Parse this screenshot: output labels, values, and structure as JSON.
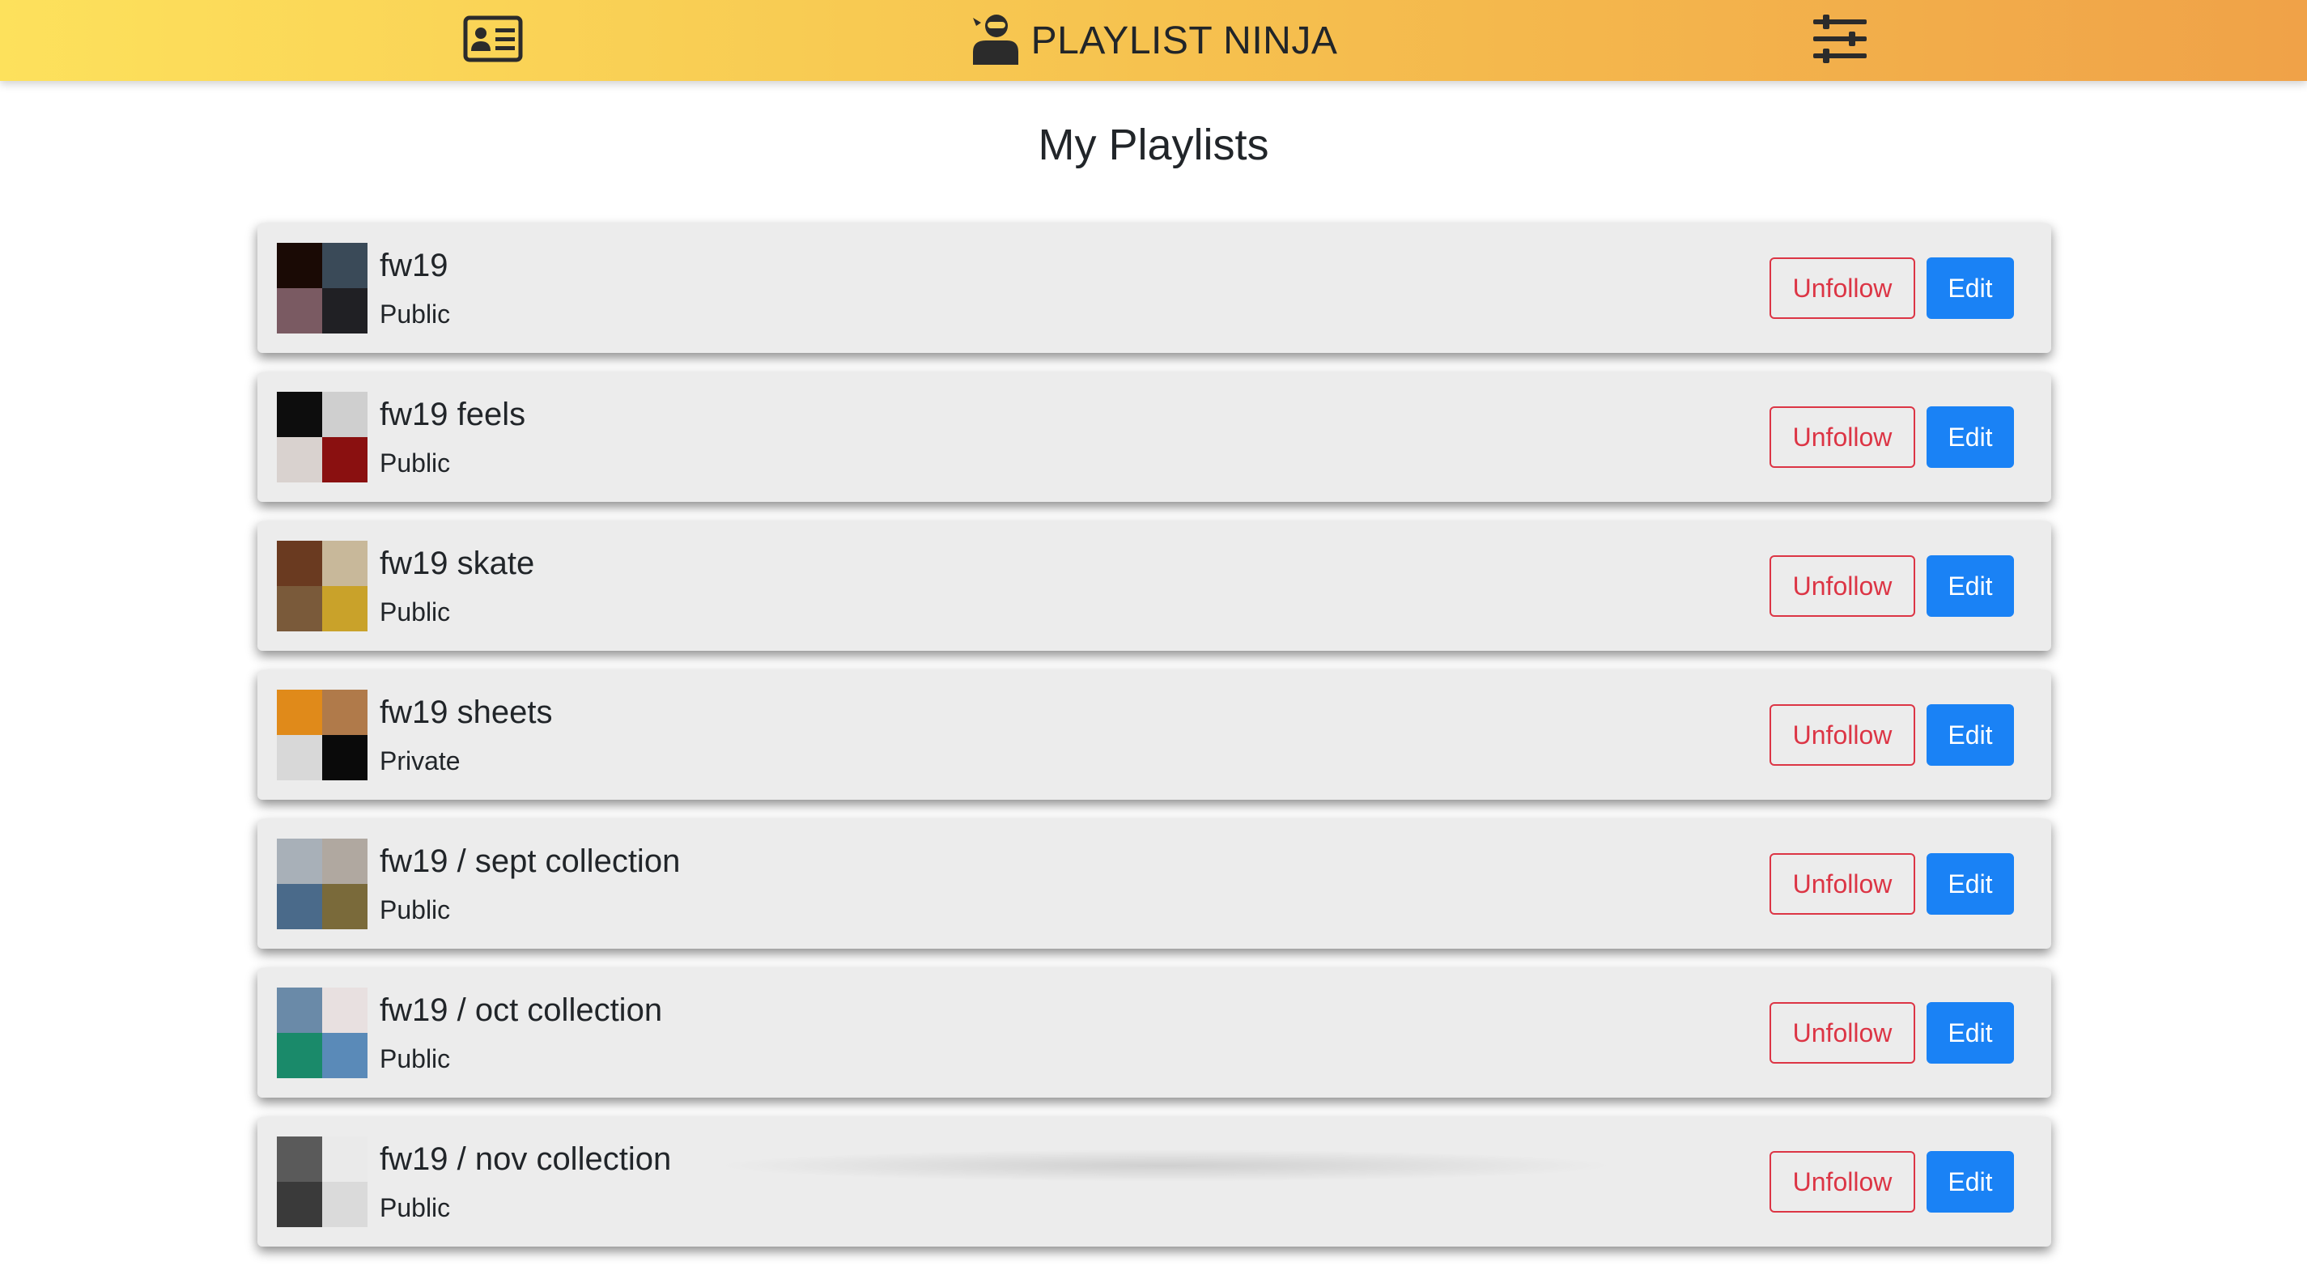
{
  "header": {
    "brand_title": "PLAYLIST NINJA",
    "gradient_colors": [
      "#fde15c",
      "#f0a248"
    ],
    "left_icon": "id-card-icon",
    "brand_icon": "ninja-icon",
    "right_icon": "sliders-icon"
  },
  "page": {
    "title": "My Playlists"
  },
  "colors": {
    "unfollow": "#dc3545",
    "edit": "#1a82f5",
    "card_bg": "#ececec"
  },
  "playlists": [
    {
      "name": "fw19",
      "visibility": "Public",
      "unfollow_label": "Unfollow",
      "edit_label": "Edit",
      "art": [
        "#1a0a05",
        "#3a4a58",
        "#7a5a62",
        "#202024"
      ]
    },
    {
      "name": "fw19 feels",
      "visibility": "Public",
      "unfollow_label": "Unfollow",
      "edit_label": "Edit",
      "art": [
        "#0d0d0d",
        "#cfcfcf",
        "#d9d2cf",
        "#8a1010"
      ]
    },
    {
      "name": "fw19 skate",
      "visibility": "Public",
      "unfollow_label": "Unfollow",
      "edit_label": "Edit",
      "art": [
        "#6a3a20",
        "#c8b89a",
        "#7a5a3a",
        "#c9a22a"
      ]
    },
    {
      "name": "fw19 sheets",
      "visibility": "Private",
      "unfollow_label": "Unfollow",
      "edit_label": "Edit",
      "art": [
        "#e08a1a",
        "#b07a4a",
        "#d8d8d8",
        "#0a0a0a"
      ]
    },
    {
      "name": "fw19 / sept collection",
      "visibility": "Public",
      "unfollow_label": "Unfollow",
      "edit_label": "Edit",
      "art": [
        "#a8b0b8",
        "#b0a8a0",
        "#4a6a8a",
        "#7a6a3a"
      ]
    },
    {
      "name": "fw19 / oct collection",
      "visibility": "Public",
      "unfollow_label": "Unfollow",
      "edit_label": "Edit",
      "art": [
        "#6a8aa8",
        "#e8e0e0",
        "#1a8a6a",
        "#5a8ab8"
      ]
    },
    {
      "name": "fw19 / nov collection",
      "visibility": "Public",
      "unfollow_label": "Unfollow",
      "edit_label": "Edit",
      "art": [
        "#5a5a5a",
        "#eaeaea",
        "#3a3a3a",
        "#dadada"
      ]
    }
  ]
}
